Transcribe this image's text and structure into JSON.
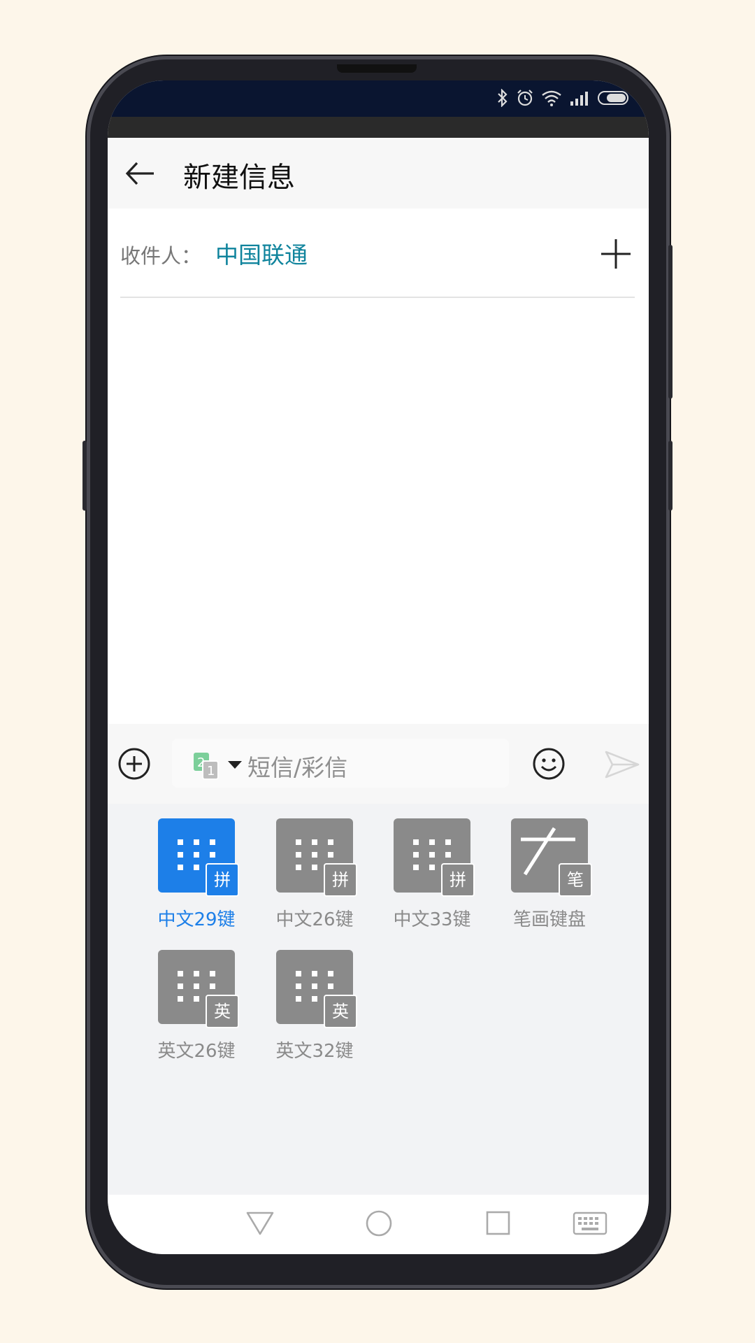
{
  "header": {
    "title": "新建信息"
  },
  "recipient": {
    "label": "收件人：",
    "value": "中国联通"
  },
  "composer": {
    "placeholder": "短信/彩信",
    "sim_icon": "sim-card-icon"
  },
  "keyboards": [
    {
      "label": "中文29键",
      "badge": "拼",
      "active": true
    },
    {
      "label": "中文26键",
      "badge": "拼",
      "active": false
    },
    {
      "label": "中文33键",
      "badge": "拼",
      "active": false
    },
    {
      "label": "笔画键盘",
      "badge": "笔",
      "active": false
    },
    {
      "label": "英文26键",
      "badge": "英",
      "active": false
    },
    {
      "label": "英文32键",
      "badge": "英",
      "active": false
    }
  ],
  "colors": {
    "accent": "#1d7fe8",
    "recipient": "#10849d",
    "tile": "#8a8a8a"
  }
}
